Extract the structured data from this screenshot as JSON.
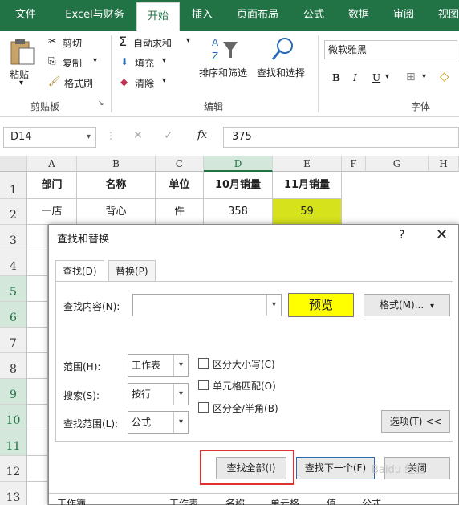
{
  "ribbon_tabs": [
    "文件",
    "Excel与财务",
    "开始",
    "插入",
    "页面布局",
    "公式",
    "数据",
    "审阅",
    "视图"
  ],
  "ribbon_active_tab": "开始",
  "clipboard": {
    "paste": "粘贴",
    "cut": "剪切",
    "copy": "复制",
    "format_painter": "格式刷",
    "group": "剪贴板"
  },
  "editing": {
    "autosum": "自动求和",
    "fill": "填充",
    "clear": "清除",
    "sort_filter": "排序和筛选",
    "find_select": "查找和选择",
    "group": "编辑"
  },
  "font": {
    "name": "微软雅黑",
    "bold": "B",
    "italic": "I",
    "underline": "U",
    "group": "字体"
  },
  "formula_bar": {
    "name_box": "D14",
    "fx": "fx",
    "value": "375"
  },
  "columns": [
    "A",
    "B",
    "C",
    "D",
    "E",
    "F",
    "G",
    "H"
  ],
  "rows": [
    "1",
    "2",
    "3",
    "4",
    "5",
    "6",
    "7",
    "8",
    "9",
    "10",
    "11",
    "12",
    "13"
  ],
  "table": {
    "headers": [
      "部门",
      "名称",
      "单位",
      "10月销量",
      "11月销量"
    ],
    "row2": [
      "一店",
      "背心",
      "件",
      "358",
      "59"
    ]
  },
  "bottom_results": [
    "工作簿",
    "工作表",
    "名称",
    "单元格",
    "值",
    "公式"
  ],
  "dialog": {
    "title": "查找和替换",
    "help": "?",
    "close": "✕",
    "tab_find": "查找(D)",
    "tab_replace": "替换(P)",
    "find_label": "查找内容(N):",
    "find_value": "",
    "preview": "预览",
    "format_button": "格式(M)...",
    "within_label": "范围(H):",
    "within_value": "工作表",
    "search_label": "搜索(S):",
    "search_value": "按行",
    "lookin_label": "查找范围(L):",
    "lookin_value": "公式",
    "match_case": "区分大小写(C)",
    "match_cell": "单元格匹配(O)",
    "match_width": "区分全/半角(B)",
    "options_button": "选项(T) <<",
    "find_all": "查找全部(I)",
    "find_next": "查找下一个(F)",
    "close_button": "关闭"
  },
  "watermark": "Baidu 经验",
  "colors": {
    "excel_green": "#217346",
    "highlight_yellow": "#ffff00",
    "cell_yellow": "#d6e21c",
    "red_box": "#e03030"
  }
}
